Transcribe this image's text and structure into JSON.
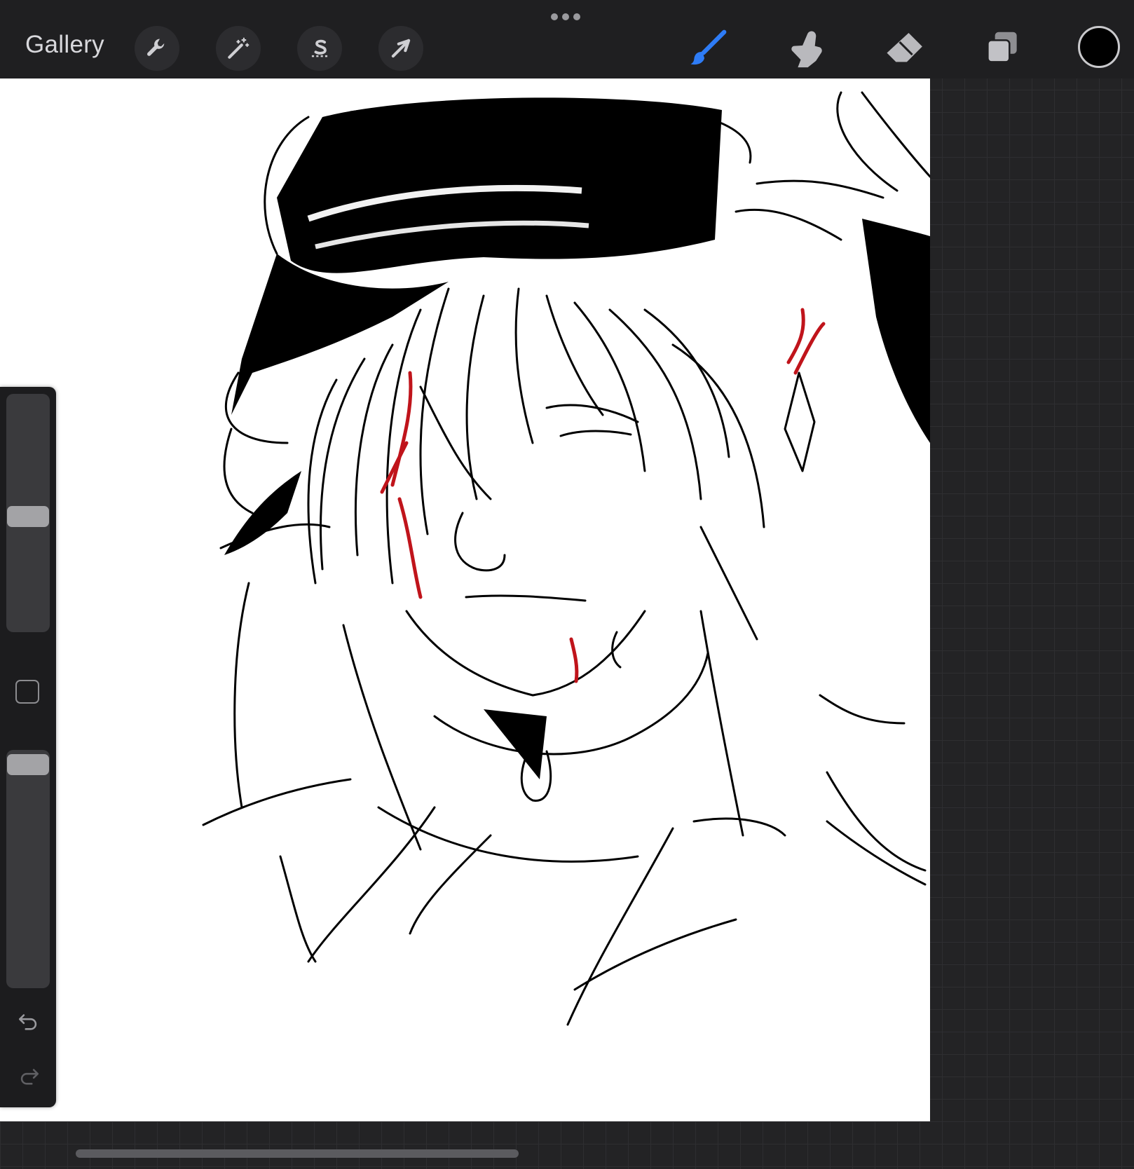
{
  "app": {
    "gallery_label": "Gallery",
    "more_menu_icon": "ellipsis-icon"
  },
  "toolbar_left": [
    {
      "name": "actions",
      "icon": "wrench-icon"
    },
    {
      "name": "adjustments",
      "icon": "magic-wand-icon"
    },
    {
      "name": "selection",
      "icon": "selection-s-icon"
    },
    {
      "name": "transform",
      "icon": "arrow-cursor-icon"
    }
  ],
  "toolbar_right": [
    {
      "name": "brush",
      "icon": "brush-icon",
      "active": true
    },
    {
      "name": "smudge",
      "icon": "smudge-finger-icon",
      "active": false
    },
    {
      "name": "eraser",
      "icon": "eraser-icon",
      "active": false
    },
    {
      "name": "layers",
      "icon": "layers-icon",
      "active": false
    }
  ],
  "colors": {
    "active_tool": "#2e7cf6",
    "current_color": "#000000",
    "accent_red": "#c0141b",
    "toolbar_bg": "#1f1f21",
    "canvas_bg": "#ffffff"
  },
  "sidebar": {
    "brush_size_level": 0.52,
    "opacity_level": 0.96,
    "undo_icon": "undo-icon",
    "redo_icon": "redo-icon",
    "modify_icon": "square-modify-icon"
  }
}
